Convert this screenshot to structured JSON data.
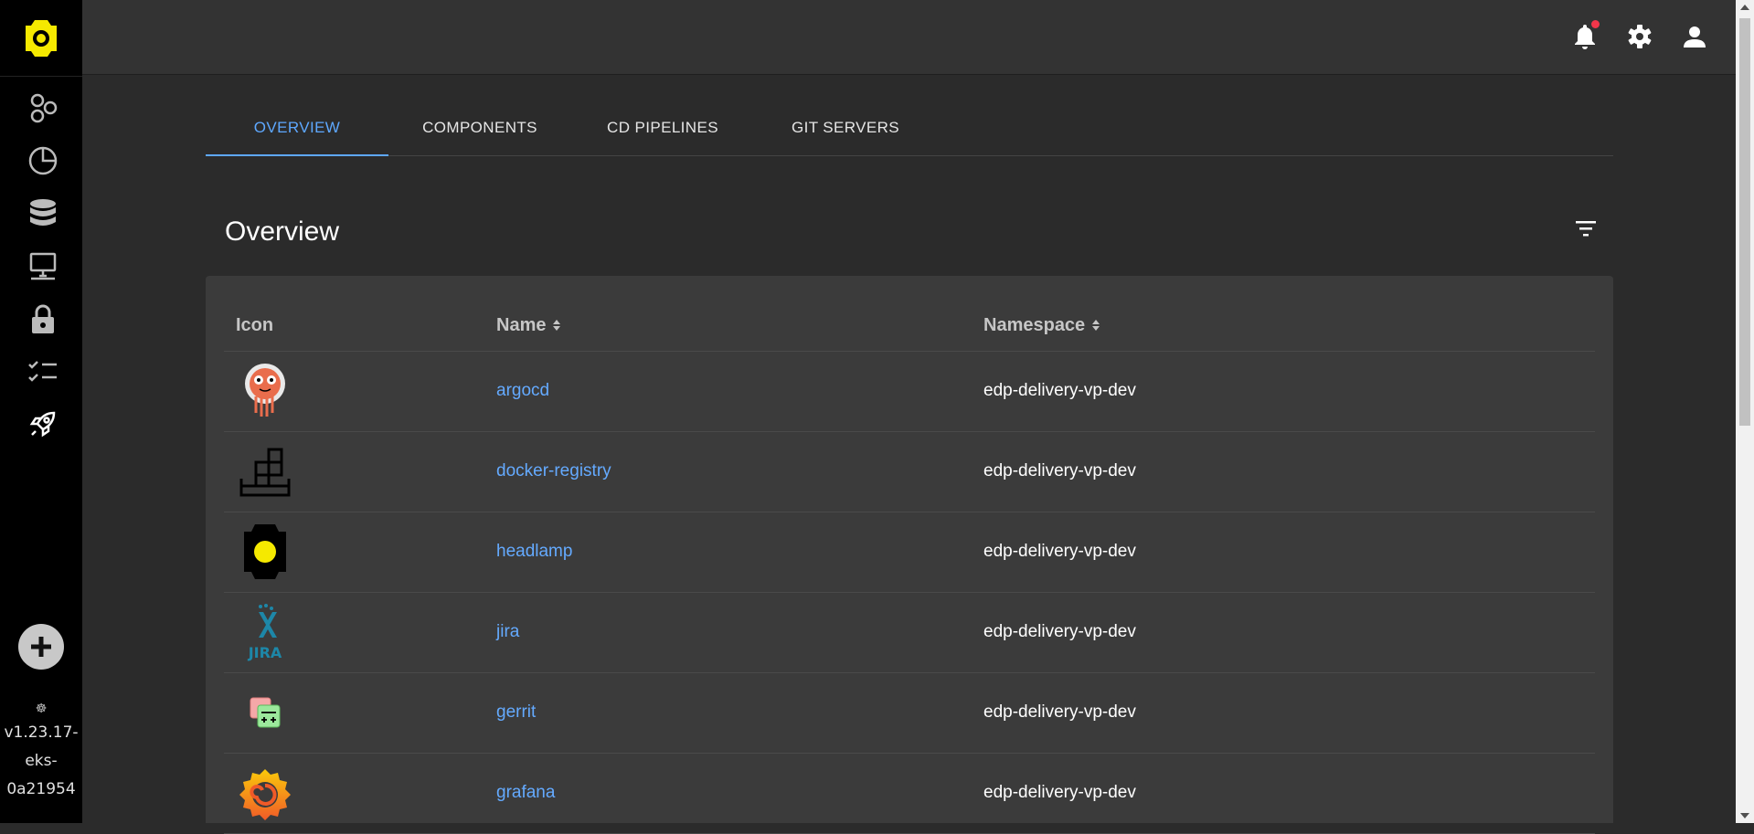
{
  "sidebar": {
    "logo_icon": "headlamp-logo-icon",
    "items": [
      {
        "name": "cluster",
        "icon": "hexagons-icon"
      },
      {
        "name": "workloads",
        "icon": "pie-chart-icon"
      },
      {
        "name": "storage",
        "icon": "database-icon"
      },
      {
        "name": "network",
        "icon": "network-desktop-icon"
      },
      {
        "name": "security",
        "icon": "lock-icon"
      },
      {
        "name": "configuration",
        "icon": "checklist-icon"
      },
      {
        "name": "edp",
        "icon": "rocket-icon"
      }
    ],
    "add_icon": "plus-circle-icon",
    "version_lines": [
      "v1.23.17-",
      "eks-",
      "0a21954"
    ]
  },
  "topbar": {
    "icons": [
      "bell-icon",
      "gear-icon",
      "user-icon"
    ],
    "notification_dot_color": "#f2364a"
  },
  "tabs": [
    {
      "label": "OVERVIEW",
      "active": true
    },
    {
      "label": "COMPONENTS",
      "active": false
    },
    {
      "label": "CD PIPELINES",
      "active": false
    },
    {
      "label": "GIT SERVERS",
      "active": false
    }
  ],
  "overview": {
    "title": "Overview",
    "filter_icon": "filter-icon"
  },
  "table": {
    "columns": [
      "Icon",
      "Name",
      "Namespace"
    ],
    "rows": [
      {
        "icon": "argocd-icon",
        "name": "argocd",
        "namespace": "edp-delivery-vp-dev"
      },
      {
        "icon": "docker-registry-icon",
        "name": "docker-registry",
        "namespace": "edp-delivery-vp-dev"
      },
      {
        "icon": "headlamp-icon",
        "name": "headlamp",
        "namespace": "edp-delivery-vp-dev"
      },
      {
        "icon": "jira-icon",
        "name": "jira",
        "namespace": "edp-delivery-vp-dev"
      },
      {
        "icon": "gerrit-icon",
        "name": "gerrit",
        "namespace": "edp-delivery-vp-dev"
      },
      {
        "icon": "grafana-icon",
        "name": "grafana",
        "namespace": "edp-delivery-vp-dev"
      }
    ]
  },
  "colors": {
    "accent": "#5ea8ff",
    "link": "#64aaff",
    "logo_yellow": "#f5e900"
  }
}
